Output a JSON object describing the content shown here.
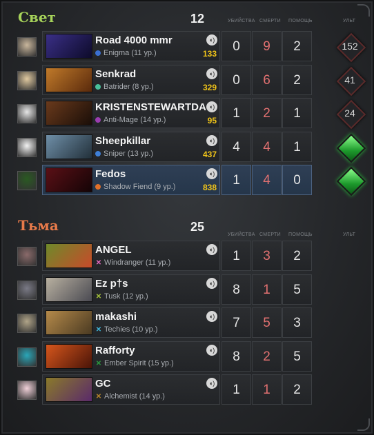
{
  "columns": {
    "kills": "Убийства",
    "deaths": "Смерти",
    "assists": "Помощь",
    "ult": "Ульт"
  },
  "radiant": {
    "name": "Свет",
    "score": "12",
    "color": "#a6d25a",
    "players": [
      {
        "name": "Road 4000 mmr",
        "hero": "Enigma (11 ур.)",
        "hero_color": "#3b6fd1",
        "gold": "133",
        "kills": "0",
        "deaths": "9",
        "assists": "2",
        "ult": "152",
        "ult_ready": false,
        "avatar_color": "#c9b69c",
        "portrait": [
          "#3a2f86",
          "#0d0b2a"
        ],
        "highlight": false
      },
      {
        "name": "Senkrad",
        "hero": "Batrider (8 ур.)",
        "hero_color": "#49c09a",
        "gold": "329",
        "kills": "0",
        "deaths": "6",
        "assists": "2",
        "ult": "41",
        "ult_ready": false,
        "avatar_color": "#e0c9a0",
        "portrait": [
          "#c07a2a",
          "#5a2a0c"
        ],
        "highlight": false
      },
      {
        "name": "KRISTENSTEWARTDA",
        "hero": "Anti-Mage (14 ур.)",
        "hero_color": "#9b3db0",
        "gold": "95",
        "kills": "1",
        "deaths": "2",
        "assists": "1",
        "ult": "24",
        "ult_ready": false,
        "avatar_color": "#e6e6e6",
        "portrait": [
          "#6a3a1c",
          "#1a0e08"
        ],
        "highlight": false
      },
      {
        "name": "Sheepkillar",
        "hero": "Sniper (13 ур.)",
        "hero_color": "#3e7fd6",
        "gold": "437",
        "kills": "4",
        "deaths": "4",
        "assists": "1",
        "ult": "",
        "ult_ready": true,
        "avatar_color": "#f2f2f2",
        "portrait": [
          "#6f8fa8",
          "#22303a"
        ],
        "highlight": false
      },
      {
        "name": "Fedos",
        "hero": "Shadow Fiend (9 ур.)",
        "hero_color": "#e0702a",
        "gold": "838",
        "kills": "1",
        "deaths": "4",
        "assists": "0",
        "ult": "",
        "ult_ready": true,
        "avatar_color": "#2a5a22",
        "portrait": [
          "#5a1016",
          "#140406"
        ],
        "highlight": true
      }
    ]
  },
  "dire": {
    "name": "Тьма",
    "score": "25",
    "color": "#e87a4a",
    "players": [
      {
        "name": "ANGEL",
        "hero": "Windranger (11 ур.)",
        "hero_color": "#e66ac0",
        "gold": "",
        "kills": "1",
        "deaths": "3",
        "assists": "2",
        "avatar_color": "#8a6a6a",
        "portrait": [
          "#6e8a2a",
          "#c84a2a"
        ]
      },
      {
        "name": "Ez p†s",
        "hero": "Tusk (12 ур.)",
        "hero_color": "#a4c23a",
        "gold": "",
        "kills": "8",
        "deaths": "1",
        "assists": "5",
        "avatar_color": "#7a7a86",
        "portrait": [
          "#b8b0a0",
          "#4a4a52"
        ]
      },
      {
        "name": "makashi",
        "hero": "Techies (10 ур.)",
        "hero_color": "#3fb5d8",
        "gold": "",
        "kills": "7",
        "deaths": "5",
        "assists": "3",
        "avatar_color": "#b0a488",
        "portrait": [
          "#b58a4a",
          "#4a3a22"
        ]
      },
      {
        "name": "Rafforty",
        "hero": "Ember Spirit (15 ур.)",
        "hero_color": "#2a9a3e",
        "gold": "",
        "kills": "8",
        "deaths": "2",
        "assists": "5",
        "avatar_color": "#2aa6b8",
        "portrait": [
          "#d6561c",
          "#4a1408"
        ]
      },
      {
        "name": "GC",
        "hero": "Alchemist (14 ур.)",
        "hero_color": "#b8862a",
        "gold": "",
        "kills": "1",
        "deaths": "1",
        "assists": "2",
        "avatar_color": "#f0d0d8",
        "portrait": [
          "#8a7a2a",
          "#5a2a6a"
        ]
      }
    ]
  }
}
